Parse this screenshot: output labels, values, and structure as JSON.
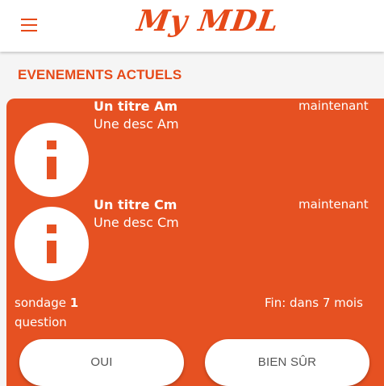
{
  "app": {
    "logo_text": "My MDL",
    "accent_color": "#e64a19",
    "card_color": "#e65122"
  },
  "header": {
    "menu_icon": "hamburger-menu-icon"
  },
  "section": {
    "title": "EVENEMENTS ACTUELS"
  },
  "events": [
    {
      "icon": "info-icon",
      "title": "Un titre Am",
      "description": "Une desc Am",
      "time": "maintenant"
    },
    {
      "icon": "info-icon",
      "title": "Un titre Cm",
      "description": "Une desc Cm",
      "time": "maintenant"
    }
  ],
  "poll": {
    "title_word": "sondage",
    "title_number": "1",
    "question": "question",
    "end": "Fin: dans 7 mois",
    "options": [
      {
        "label": "OUI"
      },
      {
        "label": "BIEN SÛR"
      }
    ]
  }
}
